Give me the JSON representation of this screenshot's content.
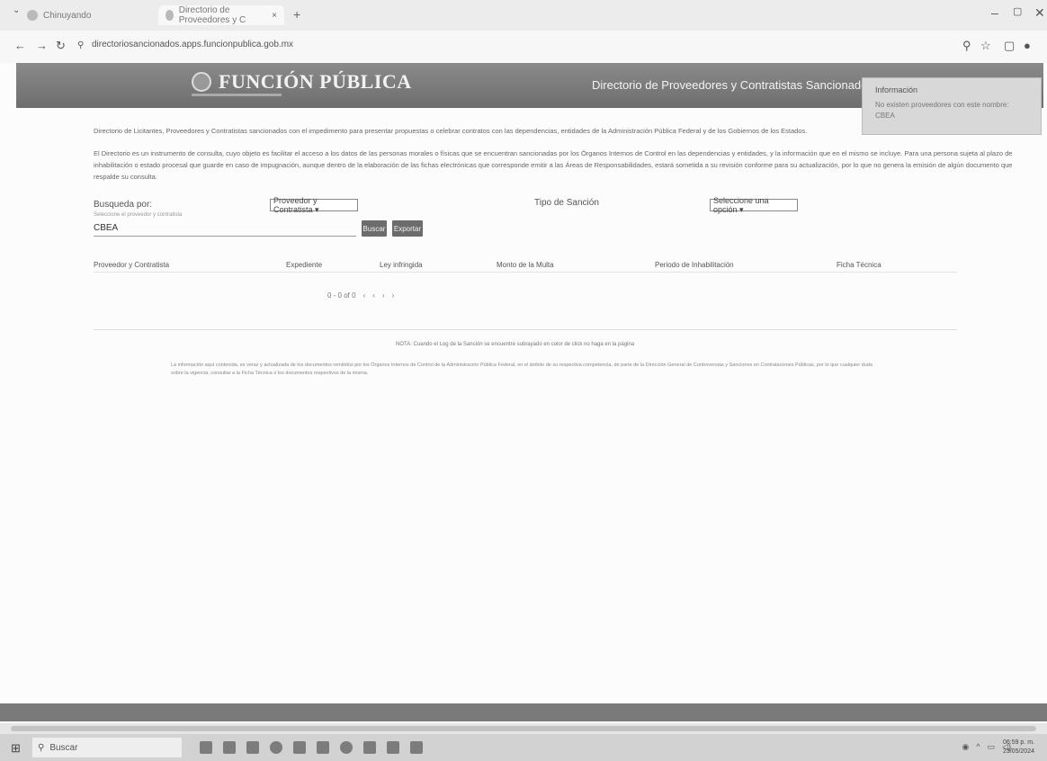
{
  "browser": {
    "tab1_title": "Chinuyando",
    "tab2_title": "Directorio de Proveedores y C",
    "tab_close": "×",
    "new_tab": "+",
    "url": "directoriosancionados.apps.funcionpublica.gob.mx"
  },
  "site": {
    "logo_text": "FUNCIÓN PÚBLICA",
    "header_title": "Directorio de Proveedores y Contratistas Sancionados"
  },
  "info_popup": {
    "title": "Información",
    "message": "No existen proveedores con este nombre: CBEA"
  },
  "intro_text": "Directorio de Licitantes, Proveedores y Contratistas sancionados con el impedimento para presentar propuestas o celebrar contratos con las dependencias, entidades de la Administración Pública Federal y de los Gobiernos de los Estados.",
  "description_text": "El Directorio es un instrumento de consulta, cuyo objeto es facilitar el acceso a los datos de las personas morales o físicas que se encuentran sancionadas por los Órganos Internos de Control en las dependencias y entidades, y la información que en el mismo se incluye. Para una persona sujeta al plazo de inhabilitación o estado procesal que guarde en caso de impugnación, aunque dentro de la elaboración de las fichas electrónicas que corresponde emitir a las Áreas de Responsabilidades, estará sometida a su revisión conforme para su actualización, por lo que no genera la emisión de algún documento que respalde su consulta.",
  "search": {
    "by_label": "Busqueda por:",
    "by_hint": "Seleccione el proveedor y contratista",
    "by_value": "Proveedor y Contratista ▾",
    "type_label": "Tipo de Sanción",
    "type_value": "Seleccione una opción ▾",
    "input_value": "CBEA",
    "search_button": "Buscar",
    "export_button": "Exportar"
  },
  "table": {
    "headers": [
      "Proveedor y Contratista",
      "Expediente",
      "Ley infringida",
      "Monto de la Multa",
      "Periodo de Inhabilitación",
      "Ficha Técnica"
    ],
    "range": "0 - 0 of 0",
    "nav": [
      "‹",
      "‹",
      "›",
      "›"
    ]
  },
  "note": "NOTA: Cuando el Log de la Sanción se encuentre subrayado en color de click no haga en la página",
  "disclaimer": "La información aquí contenida, es veraz y actualizada de los documentos remitidos por los Órganos Internos de Control de la Administración Pública Federal, en el ámbito de su respectiva competencia, de parte de la Dirección General de Controversias y Sanciones en Contrataciones Públicas, por lo que cualquier duda sobre la vigencia, consultar a la Ficha Técnica o los documentos respectivos de la misma.",
  "taskbar": {
    "search_placeholder": "Buscar",
    "time": "06:59 p. m.",
    "date": "23/05/2024"
  },
  "colors": {
    "header_bg": "#7c7c7c",
    "button_bg": "#6c6c6c"
  }
}
